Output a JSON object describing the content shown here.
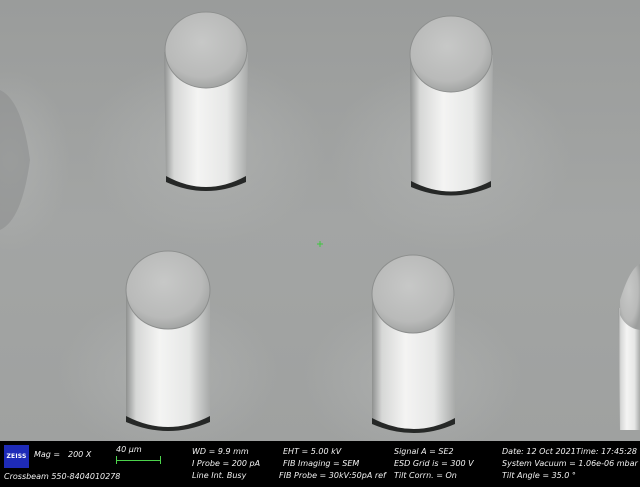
{
  "brand": {
    "logo_text": "ZEISS",
    "instrument": "Crossbeam 550-8404010278"
  },
  "fields": {
    "mag": "Mag =",
    "mag_value": "200 X",
    "scale": "40 µm",
    "wd": "WD = 9.9 mm",
    "iprobe": "I Probe = 200 pA",
    "line_int": "Line Int. Busy",
    "eht": "EHT = 5.00 kV",
    "fib_imaging": "FIB Imaging = SEM",
    "fib_probe": "FIB Probe = 30kV:50pA ref",
    "signal": "Signal A = SE2",
    "esd": "ESD Grid is = 300 V",
    "tilt_corrn": "Tilt Corrn. = On",
    "date": "Date: 12 Oct 2021",
    "time": "Time: 17:45:28",
    "vacuum": "System Vacuum = 1.06e-06 mbar",
    "tilt_angle": "Tilt Angle = 35.0 °"
  },
  "colors": {
    "scalebar": "#4cd34c",
    "logo_bg": "#1e2bb8",
    "crosshair": "#3ec83e"
  }
}
